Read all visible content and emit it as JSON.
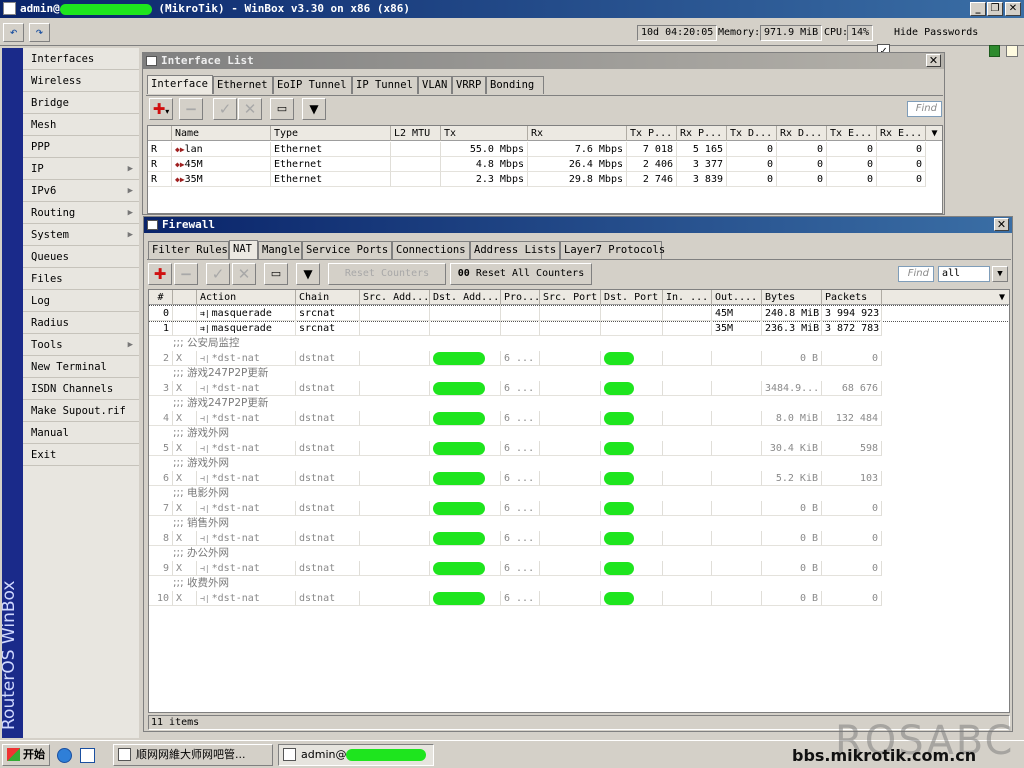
{
  "window": {
    "title_user": "admin@",
    "title_rest": " (MikroTik) - WinBox v3.30 on x86 (x86)"
  },
  "toolbar": {
    "uptime": "10d 04:20:05",
    "memory_label": "Memory:",
    "memory_value": "971.9 MiB",
    "cpu_label": "CPU:",
    "cpu_value": "14%",
    "hide_passwords": "Hide Passwords",
    "hide_passwords_checked": true
  },
  "sidebar": {
    "brand": "RouterOS WinBox",
    "items": [
      {
        "label": "Interfaces",
        "submenu": false
      },
      {
        "label": "Wireless",
        "submenu": false
      },
      {
        "label": "Bridge",
        "submenu": false
      },
      {
        "label": "Mesh",
        "submenu": false
      },
      {
        "label": "PPP",
        "submenu": false
      },
      {
        "label": "IP",
        "submenu": true
      },
      {
        "label": "IPv6",
        "submenu": true
      },
      {
        "label": "Routing",
        "submenu": true
      },
      {
        "label": "System",
        "submenu": true
      },
      {
        "label": "Queues",
        "submenu": false
      },
      {
        "label": "Files",
        "submenu": false
      },
      {
        "label": "Log",
        "submenu": false
      },
      {
        "label": "Radius",
        "submenu": false
      },
      {
        "label": "Tools",
        "submenu": true
      },
      {
        "label": "New Terminal",
        "submenu": false
      },
      {
        "label": "ISDN Channels",
        "submenu": false
      },
      {
        "label": "Make Supout.rif",
        "submenu": false
      },
      {
        "label": "Manual",
        "submenu": false
      },
      {
        "label": "Exit",
        "submenu": false
      }
    ]
  },
  "interface_list": {
    "title": "Interface List",
    "tabs": [
      "Interface",
      "Ethernet",
      "EoIP Tunnel",
      "IP Tunnel",
      "VLAN",
      "VRRP",
      "Bonding"
    ],
    "find_placeholder": "Find",
    "columns": [
      "Name",
      "Type",
      "L2 MTU",
      "Tx",
      "Rx",
      "Tx P...",
      "Rx P...",
      "Tx D...",
      "Rx D...",
      "Tx E...",
      "Rx E..."
    ],
    "rows": [
      {
        "flag": "R",
        "name": "lan",
        "type": "Ethernet",
        "l2mtu": "",
        "tx": "55.0 Mbps",
        "rx": "7.6 Mbps",
        "txp": "7 018",
        "rxp": "5 165",
        "txd": "0",
        "rxd": "0",
        "txe": "0",
        "rxe": "0"
      },
      {
        "flag": "R",
        "name": "45M",
        "type": "Ethernet",
        "l2mtu": "",
        "tx": "4.8 Mbps",
        "rx": "26.4 Mbps",
        "txp": "2 406",
        "rxp": "3 377",
        "txd": "0",
        "rxd": "0",
        "txe": "0",
        "rxe": "0"
      },
      {
        "flag": "R",
        "name": "35M",
        "type": "Ethernet",
        "l2mtu": "",
        "tx": "2.3 Mbps",
        "rx": "29.8 Mbps",
        "txp": "2 746",
        "rxp": "3 839",
        "txd": "0",
        "rxd": "0",
        "txe": "0",
        "rxe": "0"
      }
    ]
  },
  "firewall": {
    "title": "Firewall",
    "tabs": [
      "Filter Rules",
      "NAT",
      "Mangle",
      "Service Ports",
      "Connections",
      "Address Lists",
      "Layer7 Protocols"
    ],
    "reset_counters": "Reset Counters",
    "reset_all_prefix": "00",
    "reset_all_counters": "Reset All Counters",
    "find_placeholder": "Find",
    "filter_value": "all",
    "columns": [
      "#",
      "Action",
      "Chain",
      "Src. Add...",
      "Dst. Add...",
      "Pro...",
      "Src. Port",
      "Dst. Port",
      "In. ...",
      "Out....",
      "Bytes",
      "Packets"
    ],
    "rules": [
      {
        "num": "0",
        "flag": "",
        "comment": "",
        "action": "masquerade",
        "chain": "srcnat",
        "proto": "",
        "out": "45M",
        "bytes": "240.8 MiB",
        "packets": "3 994 923",
        "disabled": false
      },
      {
        "num": "1",
        "flag": "",
        "comment": "",
        "action": "masquerade",
        "chain": "srcnat",
        "proto": "",
        "out": "35M",
        "bytes": "236.3 MiB",
        "packets": "3 872 783",
        "disabled": false
      },
      {
        "num": "2",
        "flag": "X",
        "comment": ";;; 公安局监控",
        "action": "dst-nat",
        "chain": "dstnat",
        "proto": "6 ...",
        "out": "",
        "bytes": "0 B",
        "packets": "0",
        "disabled": true
      },
      {
        "num": "3",
        "flag": "X",
        "comment": ";;; 游戏247P2P更新",
        "action": "dst-nat",
        "chain": "dstnat",
        "proto": "6 ...",
        "out": "",
        "bytes": "3484.9...",
        "packets": "68 676",
        "disabled": true
      },
      {
        "num": "4",
        "flag": "X",
        "comment": ";;; 游戏247P2P更新",
        "action": "dst-nat",
        "chain": "dstnat",
        "proto": "6 ...",
        "out": "",
        "bytes": "8.0 MiB",
        "packets": "132 484",
        "disabled": true
      },
      {
        "num": "5",
        "flag": "X",
        "comment": ";;; 游戏外网",
        "action": "dst-nat",
        "chain": "dstnat",
        "proto": "6 ...",
        "out": "",
        "bytes": "30.4 KiB",
        "packets": "598",
        "disabled": true
      },
      {
        "num": "6",
        "flag": "X",
        "comment": ";;; 游戏外网",
        "action": "dst-nat",
        "chain": "dstnat",
        "proto": "6 ...",
        "out": "",
        "bytes": "5.2 KiB",
        "packets": "103",
        "disabled": true
      },
      {
        "num": "7",
        "flag": "X",
        "comment": ";;; 电影外网",
        "action": "dst-nat",
        "chain": "dstnat",
        "proto": "6 ...",
        "out": "",
        "bytes": "0 B",
        "packets": "0",
        "disabled": true
      },
      {
        "num": "8",
        "flag": "X",
        "comment": ";;; 销售外网",
        "action": "dst-nat",
        "chain": "dstnat",
        "proto": "6 ...",
        "out": "",
        "bytes": "0 B",
        "packets": "0",
        "disabled": true
      },
      {
        "num": "9",
        "flag": "X",
        "comment": ";;; 办公外网",
        "action": "dst-nat",
        "chain": "dstnat",
        "proto": "6 ...",
        "out": "",
        "bytes": "0 B",
        "packets": "0",
        "disabled": true
      },
      {
        "num": "10",
        "flag": "X",
        "comment": ";;; 收费外网",
        "action": "dst-nat",
        "chain": "dstnat",
        "proto": "6 ...",
        "out": "",
        "bytes": "0 B",
        "packets": "0",
        "disabled": true
      }
    ],
    "status": "11 items"
  },
  "taskbar": {
    "start": "开始",
    "task1": "顺网网維大师网吧管...",
    "task2": "admin@",
    "watermark_big": "ROSABC",
    "watermark_url": "bbs.mikrotik.com.cn"
  },
  "colors": {
    "title_active": "#0a246a",
    "sidebar_stripe": "#1a2a8a",
    "redaction_green": "#1ee51e",
    "add_red": "#d01010"
  }
}
